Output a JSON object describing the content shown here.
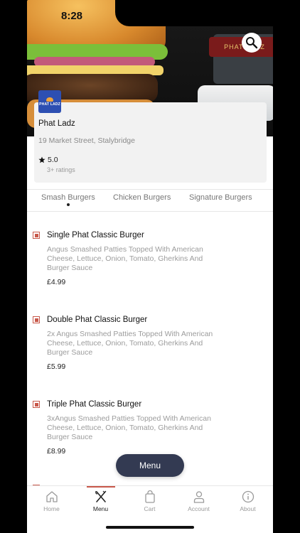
{
  "status_bar": {
    "time": "8:28"
  },
  "hero": {
    "box_brand": "PHAT LADZ",
    "search_icon": "search-icon"
  },
  "restaurant": {
    "logo_text": "PHAT LADZ",
    "name": "Phat Ladz",
    "address": "19 Market Street, Stalybridge",
    "rating": "5.0",
    "rating_count": "3+ ratings"
  },
  "tabs": [
    {
      "label": "Smash Burgers",
      "active": true
    },
    {
      "label": "Chicken Burgers",
      "active": false
    },
    {
      "label": "Signature Burgers",
      "active": false
    }
  ],
  "items": [
    {
      "name": "Single Phat Classic Burger",
      "description": "Angus Smashed Patties Topped With American Cheese, Lettuce, Onion, Tomato, Gherkins And Burger Sauce",
      "price": "£4.99"
    },
    {
      "name": "Double Phat Classic Burger",
      "description": "2x Angus Smashed Patties Topped With American Cheese, Lettuce, Onion, Tomato, Gherkins And Burger Sauce",
      "price": "£5.99"
    },
    {
      "name": "Triple Phat Classic Burger",
      "description": "3xAngus Smashed Patties Topped With American Cheese, Lettuce, Onion, Tomato, Gherkins And Burger Sauce",
      "price": "£8.99"
    }
  ],
  "menu_button": {
    "label": "Menu"
  },
  "nav": [
    {
      "label": "Home",
      "icon": "home-icon",
      "active": false
    },
    {
      "label": "Menu",
      "icon": "fork-knife-icon",
      "active": true
    },
    {
      "label": "Cart",
      "icon": "shopping-bag-icon",
      "active": false
    },
    {
      "label": "Account",
      "icon": "user-icon",
      "active": false
    },
    {
      "label": "About",
      "icon": "info-icon",
      "active": false
    }
  ],
  "colors": {
    "accent": "#c8584a",
    "menu_button": "#333a52",
    "logo_blue": "#2d4fb2"
  }
}
